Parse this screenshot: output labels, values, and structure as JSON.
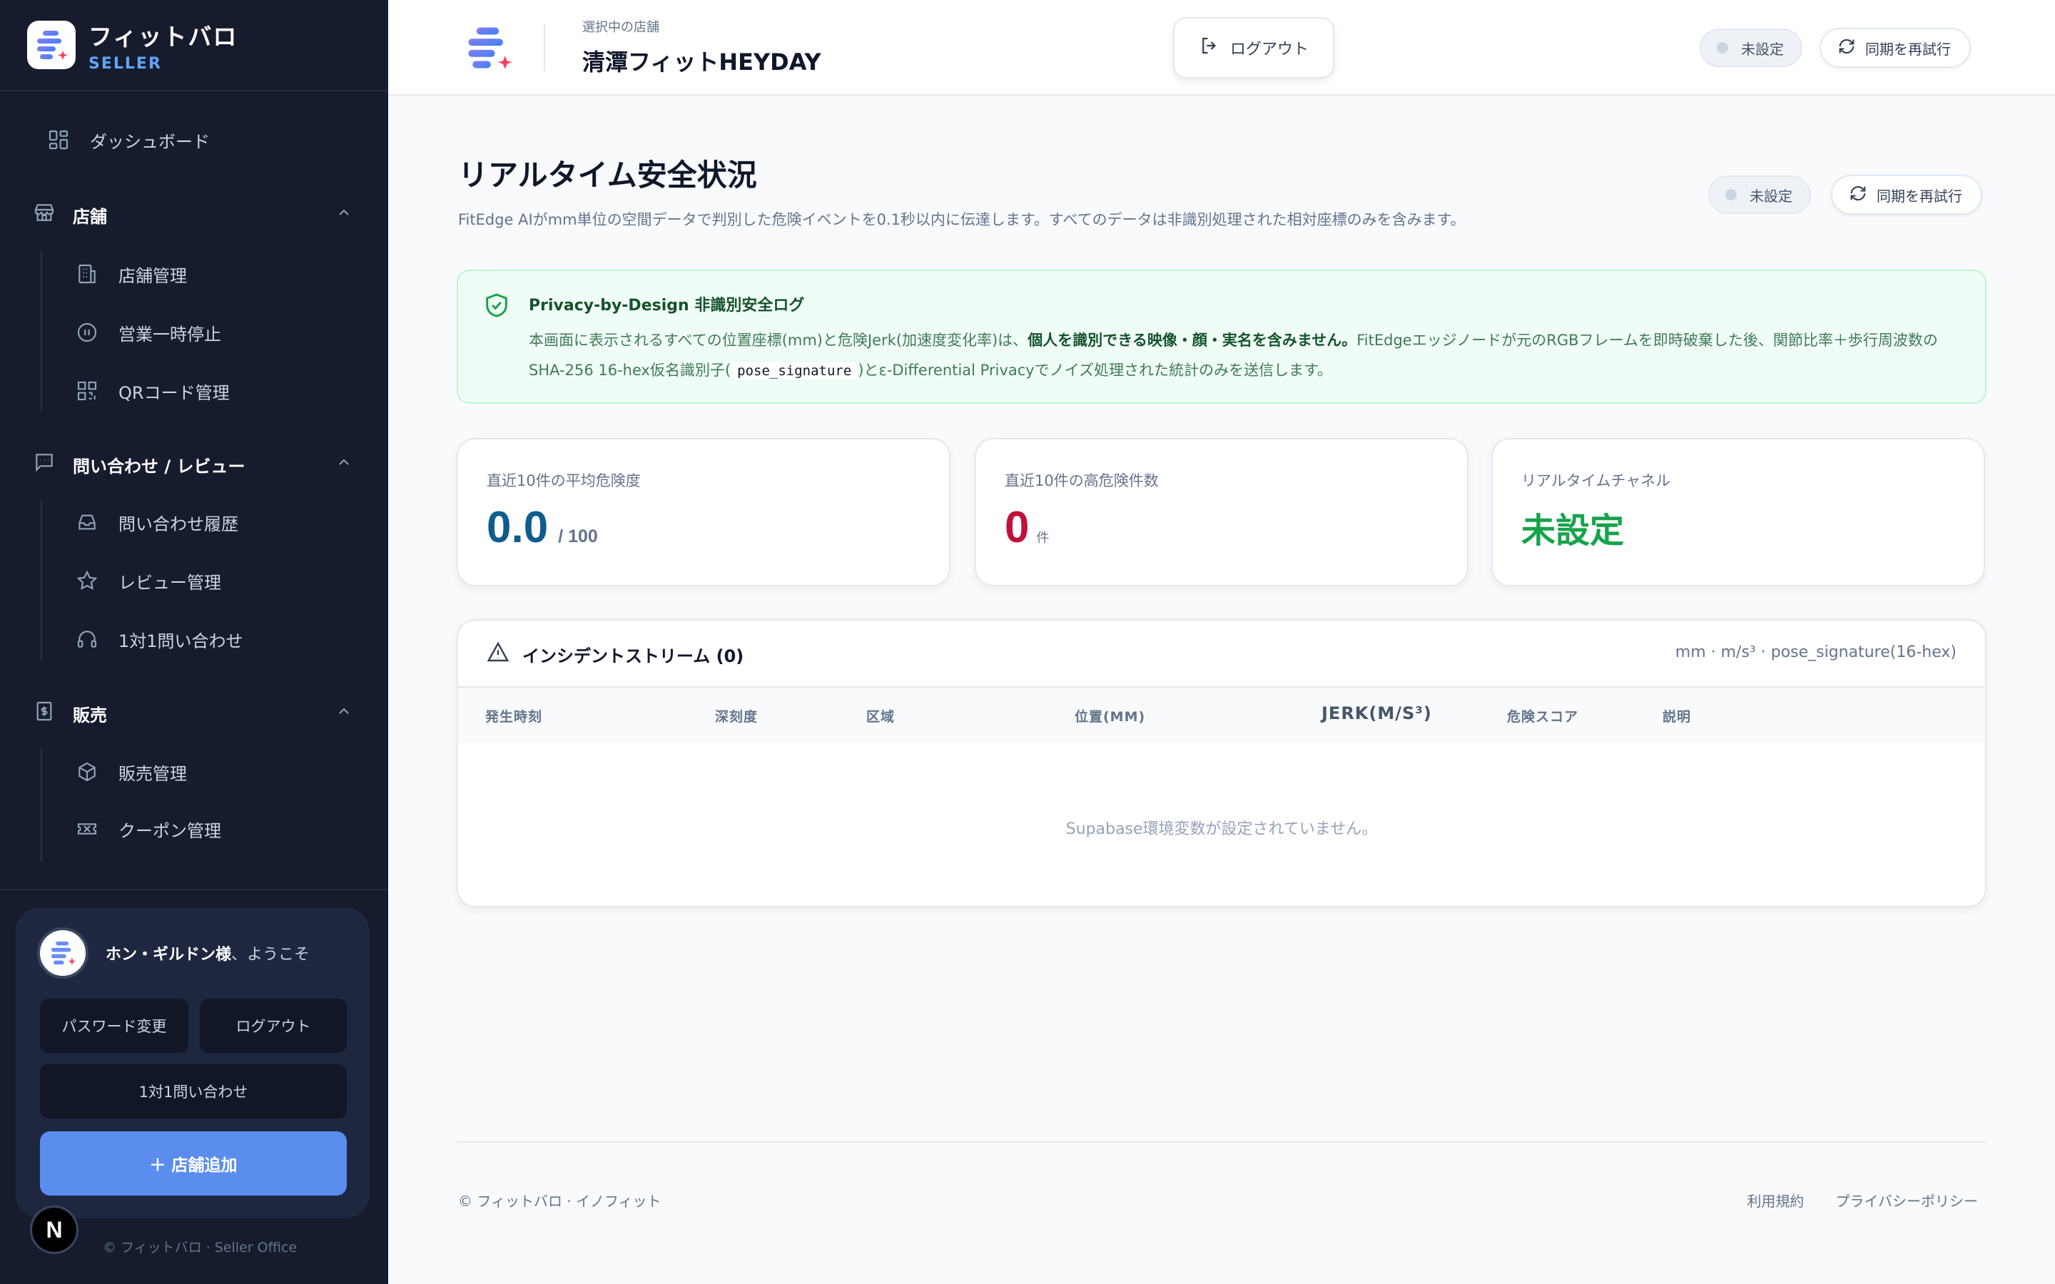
{
  "brand": {
    "name": "フィットバロ",
    "sub": "SELLER"
  },
  "nav": {
    "dashboard": "ダッシュボード",
    "sections": [
      {
        "title": "店舗",
        "items": [
          "店舗管理",
          "営業一時停止",
          "QRコード管理"
        ]
      },
      {
        "title": "問い合わせ / レビュー",
        "items": [
          "問い合わせ履歴",
          "レビュー管理",
          "1対1問い合わせ"
        ]
      },
      {
        "title": "販売",
        "items": [
          "販売管理",
          "クーポン管理"
        ]
      }
    ]
  },
  "user": {
    "name": "ホン・ギルドン様",
    "welcome_suffix": "、ようこそ",
    "password_btn": "パスワード変更",
    "logout_btn": "ログアウト",
    "inquiry_btn": "1対1問い合わせ",
    "add_store_btn": "＋ 店舗追加"
  },
  "side_badge": "N",
  "side_copyright": "© フィットバロ · Seller Office",
  "header": {
    "store_caption": "選択中の店舗",
    "store_name": "清潭フィットHEYDAY",
    "logout": "ログアウト",
    "status": "未設定",
    "retry": "同期を再試行"
  },
  "page": {
    "title": "リアルタイム安全状況",
    "description": "FitEdge AIがmm単位の空間データで判別した危険イベントを0.1秒以内に伝達します。すべてのデータは非識別処理された相対座標のみを含みます。",
    "status": "未設定",
    "retry": "同期を再試行"
  },
  "privacy": {
    "title": "Privacy-by-Design 非識別安全ログ",
    "body_1": "本画面に表示されるすべての位置座標(mm)と危険Jerk(加速度変化率)は、",
    "body_bold": "個人を識別できる映像・顔・実名を含みません。",
    "body_2": "FitEdgeエッジノードが元のRGBフレームを即時破棄した後、関節比率＋歩行周波数のSHA-256 16-hex仮名識別子(",
    "code": "pose_signature",
    "body_3": ")とε-Differential Privacyでノイズ処理された統計のみを送信します。"
  },
  "kpis": {
    "avg_label": "直近10件の平均危険度",
    "avg_value": "0.0",
    "avg_unit": "/ 100",
    "high_label": "直近10件の高危険件数",
    "high_value": "0",
    "high_unit": "件",
    "channel_label": "リアルタイムチャネル",
    "channel_value": "未設定"
  },
  "stream": {
    "title": "インシデントストリーム (0)",
    "units": "mm · m/s³ · pose_signature(16-hex)",
    "columns": [
      "発生時刻",
      "深刻度",
      "区域",
      "位置(MM)",
      "JERK(M/S³)",
      "危険スコア",
      "説明"
    ],
    "empty": "Supabase環境変数が設定されていません。"
  },
  "footer": {
    "copyright": "© フィットバロ · イノフィット",
    "terms": "利用規約",
    "privacy": "プライバシーポリシー"
  },
  "colors": {
    "sidebar_bg": "#161c2d",
    "accent_blue": "#5b8def",
    "kpi_blue": "#0f5c8f",
    "kpi_red": "#be123c",
    "status_green": "#16a34a"
  }
}
